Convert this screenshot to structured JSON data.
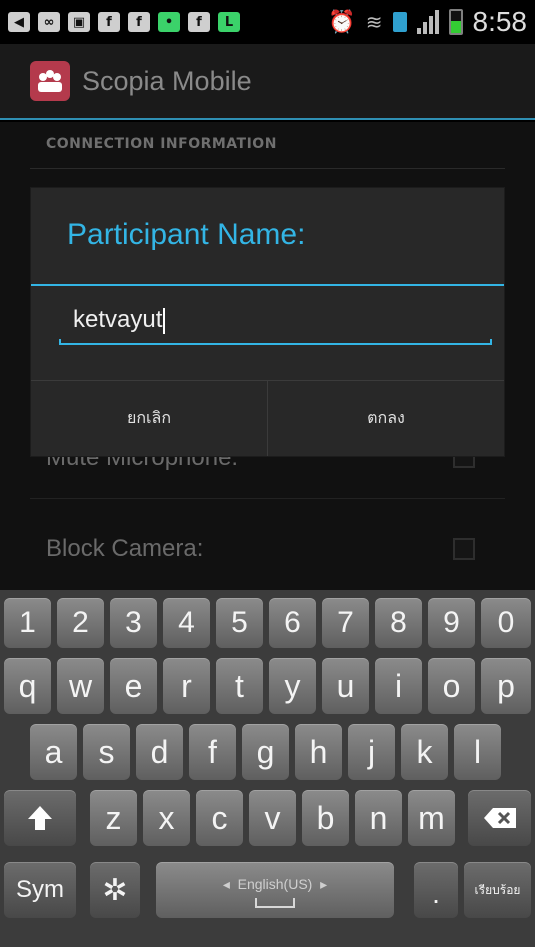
{
  "status_bar": {
    "time": "8:58",
    "left_icons": [
      "back-icon",
      "voicemail-icon",
      "image-icon",
      "facebook-icon",
      "facebook-icon",
      "chat-icon",
      "facebook-icon",
      "line-icon"
    ],
    "right_icons": [
      "alarm-icon",
      "wifi-icon",
      "data-icon",
      "signal-icon",
      "battery-icon"
    ],
    "battery_level": 0.55
  },
  "action_bar": {
    "app_title": "Scopia Mobile",
    "icon": "scopia-app-icon"
  },
  "settings": {
    "section_header": "CONNECTION INFORMATION",
    "rows": [
      {
        "label": "Mute Microphone:"
      },
      {
        "label": "Block Camera:"
      }
    ]
  },
  "dialog": {
    "title": "Participant Name:",
    "input_value": "ketvayut",
    "cancel_label": "ยกเลิก",
    "ok_label": "ตกลง"
  },
  "keyboard": {
    "number_row": [
      "1",
      "2",
      "3",
      "4",
      "5",
      "6",
      "7",
      "8",
      "9",
      "0"
    ],
    "row1": [
      "q",
      "w",
      "e",
      "r",
      "t",
      "y",
      "u",
      "i",
      "o",
      "p"
    ],
    "row2": [
      "a",
      "s",
      "d",
      "f",
      "g",
      "h",
      "j",
      "k",
      "l"
    ],
    "row3": [
      "z",
      "x",
      "c",
      "v",
      "b",
      "n",
      "m"
    ],
    "sym_label": "Sym",
    "space_label": "English(US)",
    "enter_label": "เรียบร้อย",
    "period_label": ".",
    "colors": {
      "accent": "#33b5e5"
    }
  }
}
